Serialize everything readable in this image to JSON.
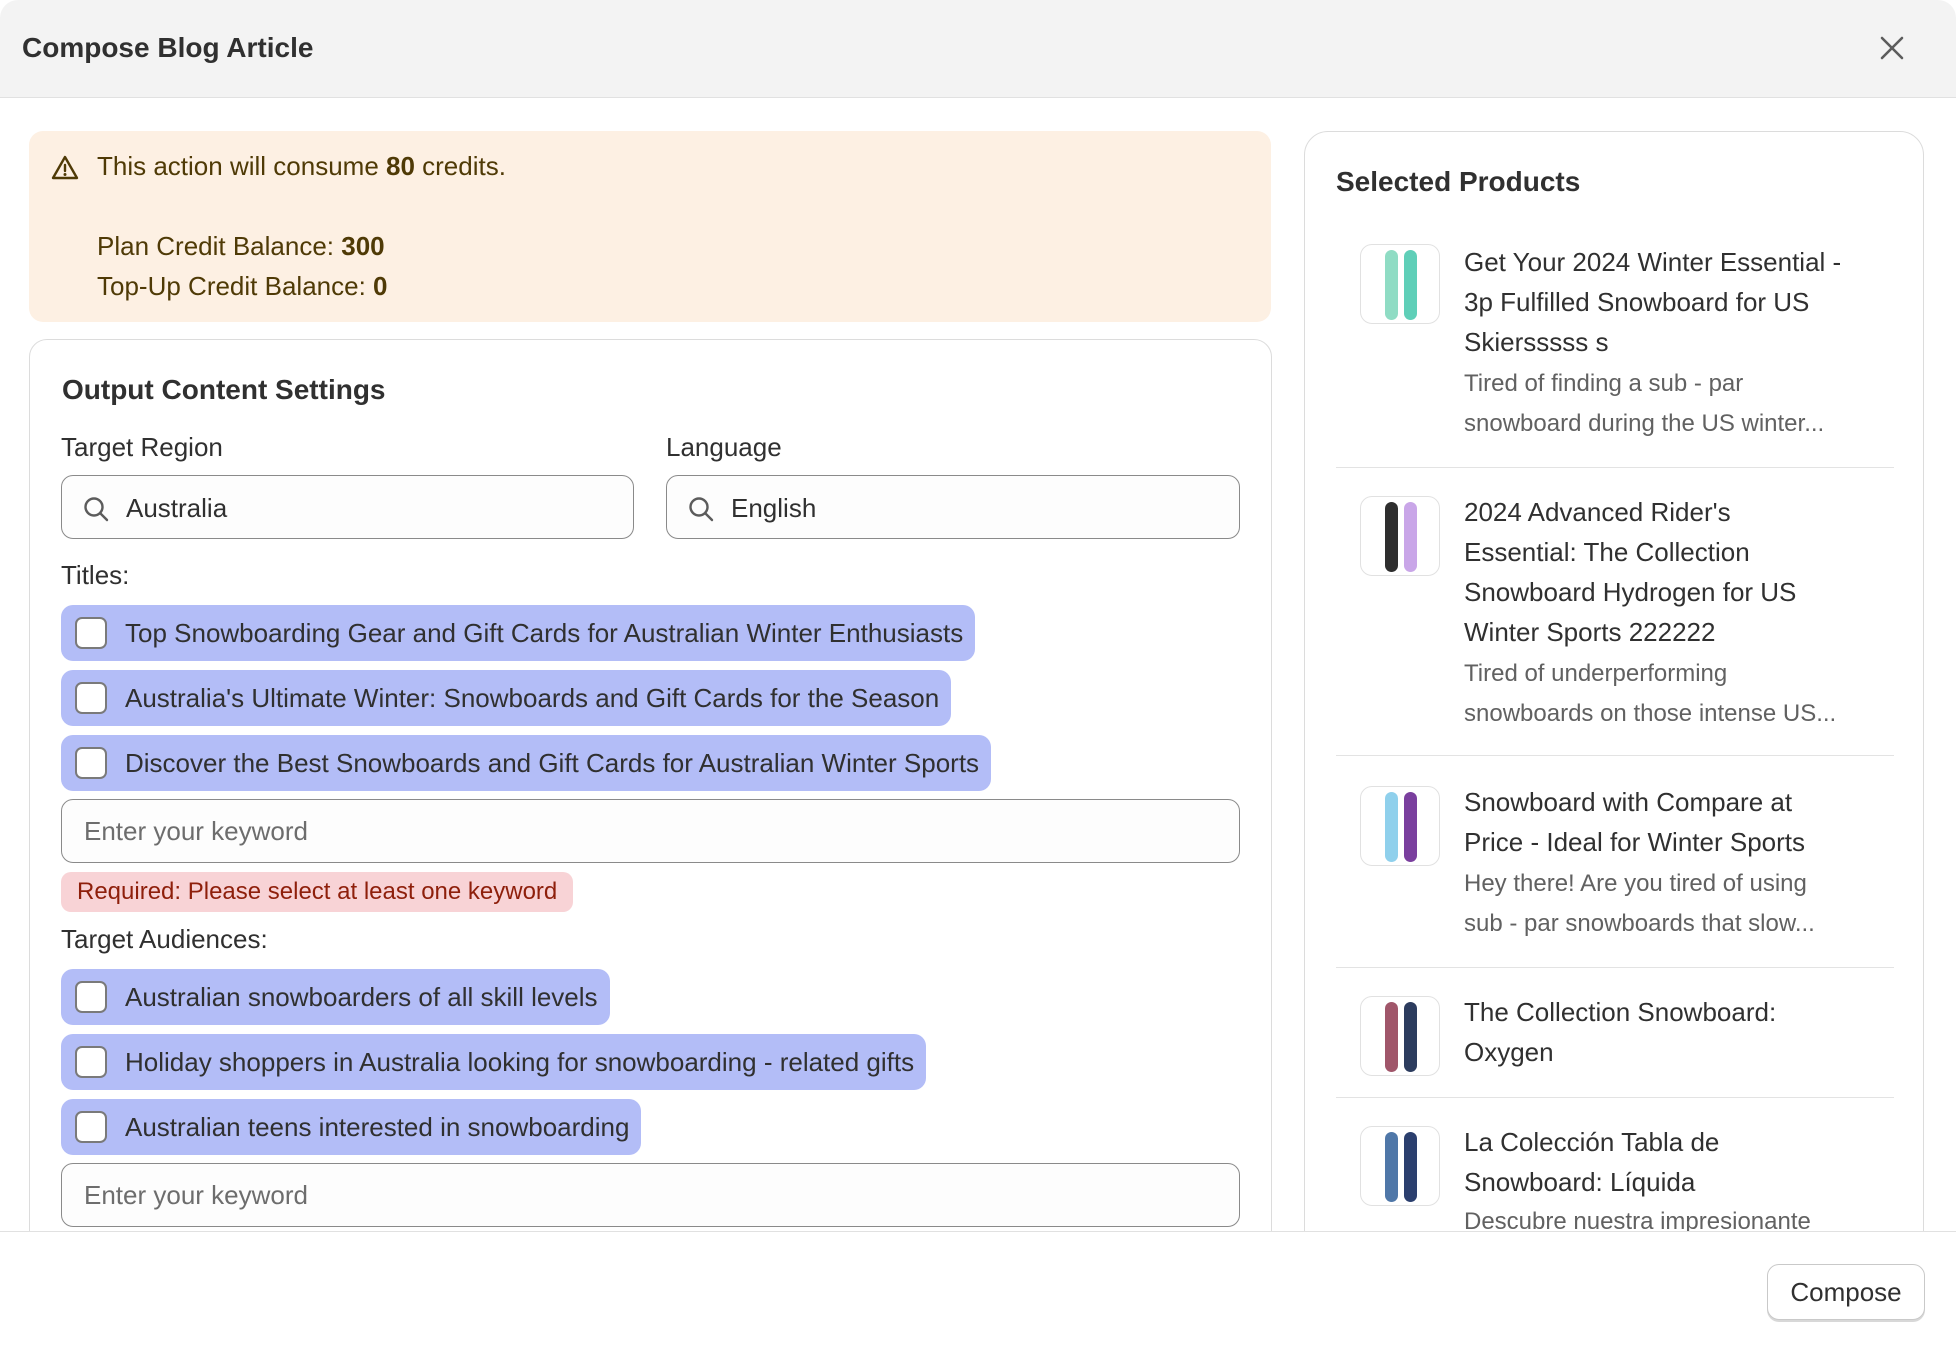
{
  "dialog": {
    "title": "Compose Blog Article",
    "close_icon": "close-icon"
  },
  "credits": {
    "prefix": "This action will consume ",
    "amount": "80",
    "suffix": " credits.",
    "plan_label": "Plan Credit Balance: ",
    "plan_value": "300",
    "topup_label": "Top-Up Credit Balance: ",
    "topup_value": "0",
    "icon": "warning-icon"
  },
  "settings": {
    "title": "Output Content Settings",
    "region_label": "Target Region",
    "region_value": "Australia",
    "language_label": "Language",
    "language_value": "English",
    "titles_label": "Titles:",
    "titles": [
      "Top Snowboarding Gear and Gift Cards for Australian Winter Enthusiasts",
      "Australia's Ultimate Winter: Snowboards and Gift Cards for the Season",
      "Discover the Best Snowboards and Gift Cards for Australian Winter Sports"
    ],
    "keyword_placeholder": "Enter your keyword",
    "error": "Required: Please select at least one keyword",
    "audiences_label": "Target Audiences:",
    "audiences": [
      "Australian snowboarders of all skill levels",
      "Holiday shoppers in Australia looking for snowboarding - related gifts",
      "Australian teens interested in snowboarding"
    ],
    "audience_placeholder": "Enter your keyword"
  },
  "products": {
    "title": "Selected Products",
    "items": [
      {
        "title_lines": [
          "Get Your 2024 Winter Essential -",
          "3p Fulfilled Snowboard for US",
          "Skiersssss s"
        ],
        "desc_lines": [
          "Tired of finding a sub - par",
          "snowboard during the US winter..."
        ],
        "colors": [
          "#8fdcc4",
          "#5fcfb8"
        ]
      },
      {
        "title_lines": [
          "2024 Advanced Rider's",
          "Essential: The Collection",
          "Snowboard Hydrogen for US",
          "Winter Sports 222222"
        ],
        "desc_lines": [
          "Tired of underperforming",
          "snowboards on those intense US..."
        ],
        "colors": [
          "#2e2e2e",
          "#c9a6e8"
        ]
      },
      {
        "title_lines": [
          "Snowboard with Compare at",
          "Price - Ideal for Winter Sports"
        ],
        "desc_lines": [
          "Hey there! Are you tired of using",
          "sub - par snowboards that slow..."
        ],
        "colors": [
          "#8fd0ec",
          "#7a3f9e"
        ]
      },
      {
        "title_lines": [
          "The Collection Snowboard:",
          "Oxygen"
        ],
        "desc_lines": [],
        "colors": [
          "#a0566a",
          "#2c3c5e"
        ]
      },
      {
        "title_lines": [
          "La Colección Tabla de",
          "Snowboard: Líquida"
        ],
        "desc_lines": [
          "Descubre nuestra impresionante"
        ],
        "colors": [
          "#4f77a8",
          "#2b3f6e"
        ]
      }
    ]
  },
  "footer": {
    "compose_label": "Compose"
  }
}
